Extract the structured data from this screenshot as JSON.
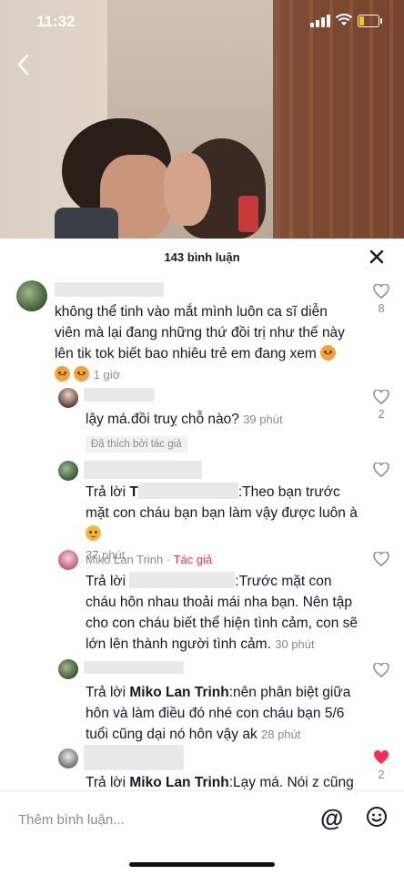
{
  "status": {
    "time": "11:32"
  },
  "sheet": {
    "count_label": "143 bình luận"
  },
  "comments": [
    {
      "text": "không thể tinh vào mắt mình luôn ca sĩ diễn viên mà lại đang những thứ đồi trị như thế này lên tik tok biết bao nhiêu trẻ em đang xem",
      "time": "1 giờ",
      "likes": "8"
    },
    {
      "text": "lậy má.đồi truỵ chỗ nào?",
      "time": "39 phút",
      "likes": "2",
      "chip": "Đã thích bởi tác giả"
    },
    {
      "reply_prefix": "Trả lời",
      "reply_to": "T",
      "text": ":Theo bạn trước mặt con cháu bạn bạn làm vậy được luôn à",
      "time": "37 phút"
    },
    {
      "author": "Miko Lan Trinh",
      "author_badge": "Tác giả",
      "reply_prefix": "Trả lời",
      "text": ":Trước mặt con cháu hôn nhau thoải mái nha bạn. Nên tập cho con cháu biết thể hiện tình cảm, con sẽ lớn lên thành người tình cảm.",
      "time": "30 phút"
    },
    {
      "reply_prefix": "Trả lời",
      "reply_to": "Miko Lan Trinh",
      "text": ":nên phân biệt giữa hôn và làm điều đó nhé con cháu bạn 5/6 tuổi cũng dại nó hôn vậy ak",
      "time": "28 phút"
    },
    {
      "reply_prefix": "Trả lời",
      "reply_to": "Miko Lan Trinh",
      "text": ":Lạy má. Nói z cũng",
      "likes": "2"
    }
  ],
  "footer": {
    "placeholder": "Thêm bình luận..."
  },
  "colors": {
    "like_active": "#fe2c55",
    "author_badge": "#fe2c55",
    "meta": "#8a8b91"
  }
}
